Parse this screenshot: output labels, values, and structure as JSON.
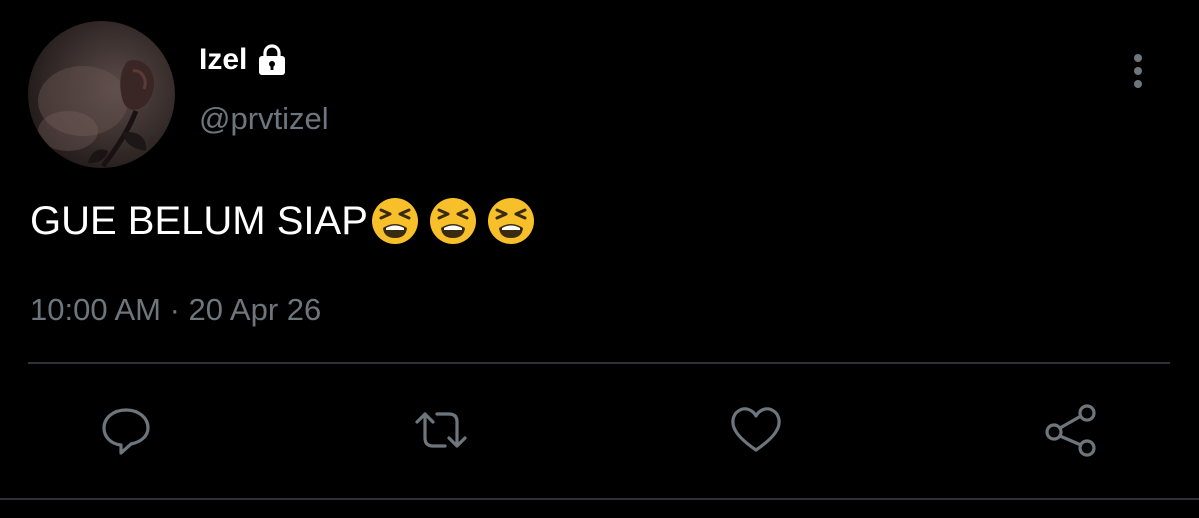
{
  "author": {
    "display_name": "Izel",
    "handle": "@prvtizel",
    "protected_icon": "lock-icon",
    "avatar": "rose-photo-avatar"
  },
  "tweet": {
    "text": "GUE BELUM SIAP",
    "emojis": [
      "tired-face-emoji",
      "tired-face-emoji",
      "tired-face-emoji"
    ],
    "timestamp": "10:00 AM · 20 Apr 26"
  },
  "actions": [
    {
      "name": "reply",
      "icon": "reply-icon"
    },
    {
      "name": "retweet",
      "icon": "retweet-icon"
    },
    {
      "name": "like",
      "icon": "heart-icon"
    },
    {
      "name": "share",
      "icon": "share-icon"
    }
  ],
  "colors": {
    "background": "#000000",
    "text_primary": "#ffffff",
    "text_secondary": "#6e767d",
    "divider": "#2f3336",
    "icon": "#6e767d"
  }
}
